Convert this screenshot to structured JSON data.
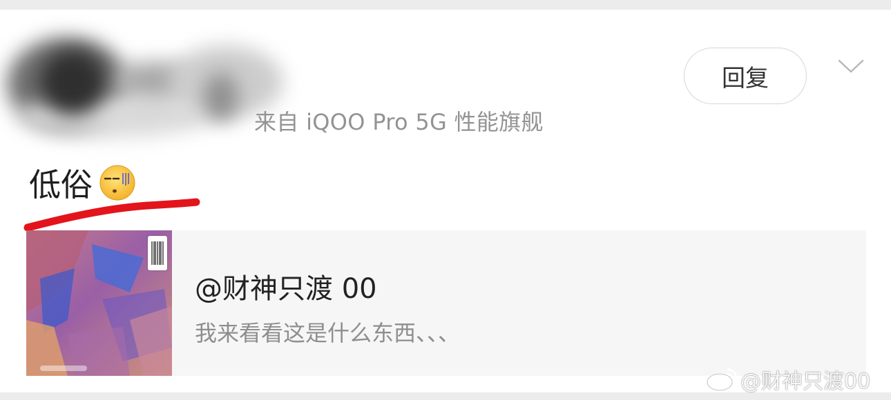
{
  "comment": {
    "source": "来自 iQOO Pro 5G 性能旗舰",
    "reply_label": "回复",
    "text": "低俗",
    "emoji_icon": "smirk-face-icon",
    "more_icon": "chevron-down-icon",
    "annotation_color": "#e3141b"
  },
  "quoted_post": {
    "author": "@财神只渡 00",
    "snippet": "我来看看这是什么东西、、、"
  },
  "watermark": {
    "logo_icon": "weibo-logo-icon",
    "text": "@财神只渡00"
  }
}
